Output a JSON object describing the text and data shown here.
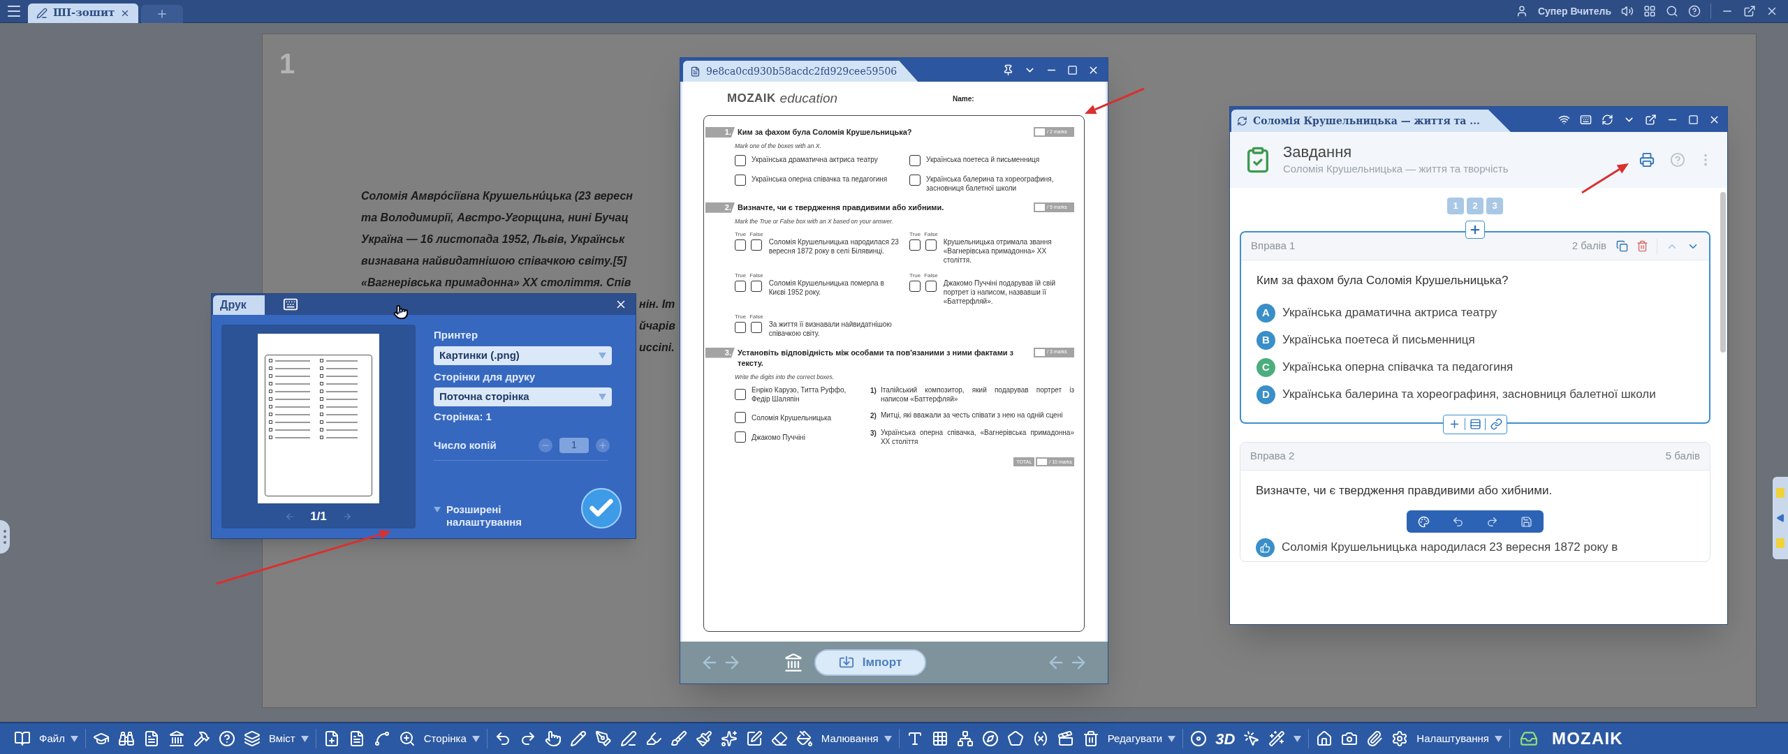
{
  "top_bar": {
    "tabs": [
      {
        "label": "ШІ-зошит",
        "selected": true
      }
    ],
    "user": "Супер Вчитель"
  },
  "page": {
    "number": "1",
    "lines": [
      "Соломія Амвро́сіївна Крушельни́цька (23 вересн",
      "та Володимирії, Австро-Угорщина, нині Бучац",
      "Україна — 16 листопада 1952, Львів, Українськ",
      "визнавана найвидатнішою співачкою світу.[5]",
      "«Вагнерівська примадонна» XX століття. Спів"
    ],
    "fragments": [
      "нін. Іт",
      "йчарів",
      "uccini."
    ]
  },
  "print_dialog": {
    "tab": "Друк",
    "preview_counter": "1/1",
    "printer_label": "Принтер",
    "printer_value": "Картинки (.png)",
    "pages_label": "Сторінки для друку",
    "pages_value": "Поточна сторінка",
    "page_info": "Сторінка: 1",
    "copies_label": "Число копій",
    "copies_value": "1",
    "advanced": "Розширені налаштування"
  },
  "worksheet": {
    "title": "9e8ca0cd930b58acdc2fd929cee59506",
    "logo": "MOZAIK",
    "logo_suffix": "education",
    "name_label": "Name:",
    "questions": [
      {
        "number": "1.",
        "kind": "choice",
        "title": "Ким за фахом була Соломія Крушельницька?",
        "marks": "/ 2 marks",
        "instruction": "Mark one of the boxes with an X.",
        "options": [
          "Українська драматична актриса театру",
          "Українська поетеса й письменниця",
          "Українська оперна співачка та педагогиня",
          "Українська балерина та хореографиня, засновниця балетної школи"
        ]
      },
      {
        "number": "2.",
        "kind": "truefalse",
        "title": "Визначте, чи є твердження правдивими або хибними.",
        "marks": "/ 5 marks",
        "instruction": "Mark the True or False box with an X based on your answer.",
        "statements": [
          {
            "text": "Соломія Крушельницька народилася 23 вересня 1872 року в селі Білявинці.",
            "true_label": "True",
            "false_label": "False"
          },
          {
            "text": "Крушельницька отримала звання «Вагнерівська примадонна» XX століття.",
            "true_label": "True",
            "false_label": "False"
          },
          {
            "text": "Соломія Крушельницька померла в Києві 1952 року.",
            "true_label": "True",
            "false_label": "False"
          },
          {
            "text": "Джакомо Пуччіні подарував їй свій портрет із написом, назвавши її «Баттерфляй».",
            "true_label": "True",
            "false_label": "False"
          },
          {
            "text": "За життя її визнавали найвидатнішою співачкою світу.",
            "true_label": "True",
            "false_label": "False"
          }
        ]
      },
      {
        "number": "3.",
        "kind": "matching",
        "title": "Установіть відповідність між особами та пов'язаними з ними фактами з тексту.",
        "marks": "/ 3 marks",
        "instruction": "Write the digits into the correct boxes.",
        "items": [
          "Енріко Карузо, Титта Руффо, Федір Шаляпін",
          "Соломія Крушельницька",
          "Джакомо Пуччіні"
        ],
        "facts": [
          {
            "number": "1)",
            "text": "Італійський композитор, який подарував портрет із написом «Баттерфляй»"
          },
          {
            "number": "2)",
            "text": "Митці, які вважали за честь співати з нею на одній сцені"
          },
          {
            "number": "3)",
            "text": "Українська оперна співачка, «Вагнерівська примадонна» XX століття"
          }
        ]
      }
    ],
    "total_label": "TOTAL",
    "total_marks": "/ 10 marks",
    "import_button": "Імпорт"
  },
  "task_panel": {
    "title": "Соломія Крушельницька — життя та ...",
    "heading": "Завдання",
    "subtitle": "Соломія Крушельницька — життя та творчість",
    "pages": [
      "1",
      "2",
      "3"
    ],
    "exercises": [
      {
        "title": "Вправа 1",
        "points": "2 балів",
        "selected": true,
        "question": "Ким за фахом була Соломія Крушельницька?",
        "options": [
          {
            "kind": "letter",
            "letter": "A",
            "text": "Українська драматична актриса театру",
            "color": "#3a8fc8"
          },
          {
            "kind": "letter",
            "letter": "B",
            "text": "Українська поетеса й письменниця",
            "color": "#3a8fc8"
          },
          {
            "kind": "letter",
            "letter": "C",
            "text": "Українська оперна співачка та педагогиня",
            "color": "#4cae7c"
          },
          {
            "kind": "letter",
            "letter": "D",
            "text": "Українська балерина та хореографиня, засновниця балетної школи",
            "color": "#3a8fc8"
          }
        ]
      },
      {
        "title": "Вправа 2",
        "points": "5 балів",
        "selected": false,
        "question": "Визначте, чи є твердження правдивими або хибними.",
        "options": [
          {
            "kind": "thumb",
            "text": "Соломія Крушельницька народилася 23 вересня 1872 року в",
            "color": "#3a8fc8"
          }
        ]
      }
    ]
  },
  "toolbar": {
    "groups": [
      {
        "label": "Файл"
      },
      {
        "label": "Вміст"
      },
      {
        "label": "Сторінка"
      },
      {
        "label": "Малювання"
      },
      {
        "label": "Редагувати"
      },
      {
        "badge": "3D"
      },
      {
        "label": "Налаштування"
      }
    ],
    "logo": "MOZAIK"
  }
}
